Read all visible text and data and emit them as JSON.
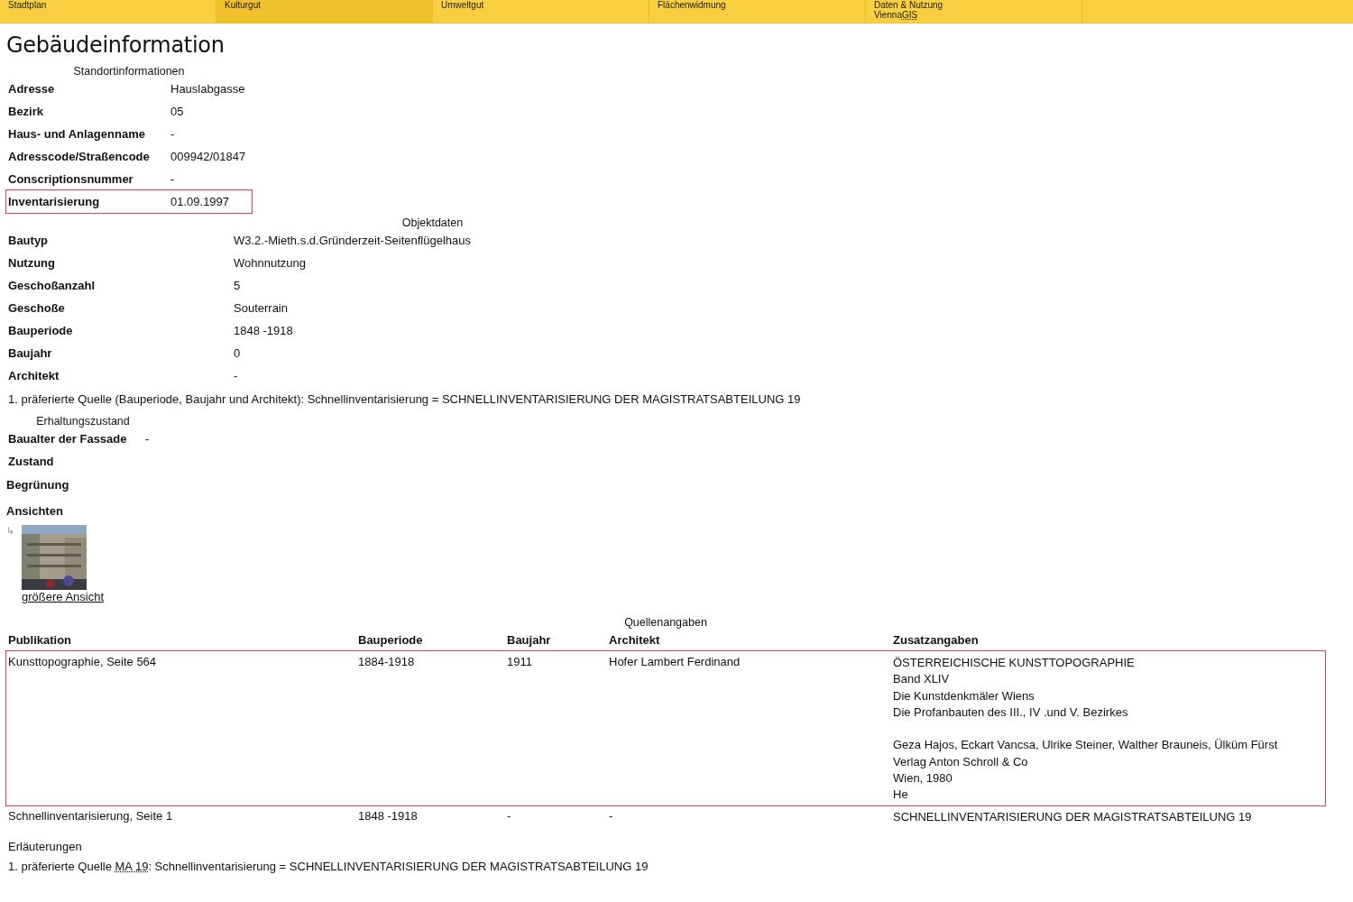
{
  "nav": [
    {
      "label": "Stadtplan",
      "selected": false
    },
    {
      "label": "Kulturgut",
      "selected": true
    },
    {
      "label": "Umweltgut",
      "selected": false
    },
    {
      "label": "Flächenwidmung",
      "selected": false
    },
    {
      "label": "Daten & Nutzung",
      "sub": "Vienna",
      "sub_abbr": "GIS",
      "selected": false
    }
  ],
  "title": "Gebäudeinformation",
  "standort": {
    "caption": "Standortinformationen",
    "rows": [
      {
        "label": "Adresse",
        "value": "Hauslabgasse",
        "highlighted": false
      },
      {
        "label": "Bezirk",
        "value": "05",
        "highlighted": false
      },
      {
        "label": "Haus- und Anlagenname",
        "value": "-",
        "highlighted": false
      },
      {
        "label": "Adresscode/Straßencode",
        "value": "009942/01847",
        "highlighted": false
      },
      {
        "label": "Conscriptionsnummer",
        "value": "-",
        "highlighted": false
      },
      {
        "label": "Inventarisierung",
        "value": "01.09.1997",
        "highlighted": true
      }
    ]
  },
  "objekt": {
    "caption": "Objektdaten",
    "rows": [
      {
        "label": "Bautyp",
        "value": "W3.2.-Mieth.s.d.Gründerzeit-Seitenflügelhaus"
      },
      {
        "label": "Nutzung",
        "value": "Wohnnutzung"
      },
      {
        "label": "Geschoßanzahl",
        "value": "5"
      },
      {
        "label": "Geschoße",
        "value": "Souterrain"
      },
      {
        "label": "Bauperiode",
        "value": "1848 -1918"
      },
      {
        "label": "Baujahr",
        "value": "0"
      },
      {
        "label": "Architekt",
        "value": "-"
      }
    ],
    "note": "1. präferierte Quelle (Bauperiode, Baujahr und Architekt): Schnellinventarisierung = SCHNELLINVENTARISIERUNG DER MAGISTRATSABTEILUNG 19"
  },
  "erhaltung": {
    "caption": "Erhaltungszustand",
    "rows": [
      {
        "label": "Baualter der Fassade",
        "value": "-"
      },
      {
        "label": "Zustand"
      }
    ]
  },
  "begruenung": "Begrünung",
  "ansichten": {
    "heading": "Ansichten",
    "arrow": "↳",
    "link": "größere Ansicht"
  },
  "quellen": {
    "caption": "Quellenangaben",
    "columns": [
      "Publikation",
      "Bauperiode",
      "Baujahr",
      "Architekt",
      "Zusatzangaben"
    ],
    "rows": [
      {
        "highlighted": true,
        "cells": [
          "Kunsttopographie, Seite 564",
          "1884-1918",
          "1911",
          "Hofer Lambert Ferdinand"
        ],
        "extra": [
          [
            "ÖSTERREICHISCHE KUNSTTOPOGRAPHIE",
            "Band XLIV",
            "Die Kunstdenkmäler Wiens",
            "Die Profanbauten des III., IV .und V. Bezirkes"
          ],
          [
            "Geza Hajos, Eckart Vancsa, Ulrike Steiner, Walther Brauneis, Ülküm Fürst",
            "Verlag Anton Schroll & Co",
            "Wien, 1980",
            "He"
          ]
        ]
      },
      {
        "highlighted": false,
        "cells": [
          "Schnellinventarisierung, Seite 1",
          "1848 -1918",
          "-",
          "-"
        ],
        "extra": [
          [
            "SCHNELLINVENTARISIERUNG DER MAGISTRATSABTEILUNG 19"
          ]
        ]
      }
    ]
  },
  "erlaeuterungen": {
    "heading": "Erläuterungen",
    "pre": "1. präferierte Quelle ",
    "abbr": "MA 19",
    "post": ": Schnellinventarisierung = SCHNELLINVENTARISIERUNG DER MAGISTRATSABTEILUNG 19"
  }
}
